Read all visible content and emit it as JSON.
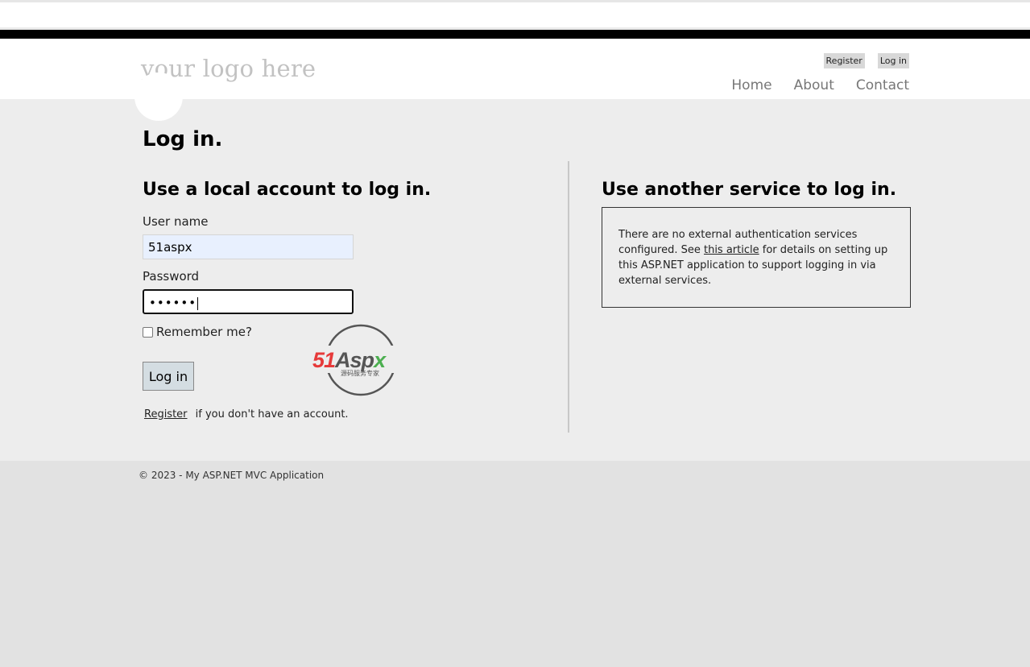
{
  "header": {
    "logo_text": "your logo here",
    "login_links": {
      "register": "Register",
      "login": "Log in"
    },
    "nav": {
      "home": "Home",
      "about": "About",
      "contact": "Contact"
    }
  },
  "main": {
    "title": "Log in.",
    "local": {
      "heading": "Use a local account to log in.",
      "username_label": "User name",
      "username_value": "51aspx",
      "password_label": "Password",
      "password_value": "••••••",
      "remember_label": "Remember me?",
      "remember_checked": false,
      "login_button": "Log in",
      "register_link": "Register",
      "register_suffix": "if you don't have an account."
    },
    "external": {
      "heading": "Use another service to log in.",
      "text_before": "There are no external authentication services configured. See",
      "link_text": "this article",
      "text_after": "for details on setting up this ASP.NET application to support logging in via external services."
    },
    "badge": {
      "brand": "51Aspx",
      "subtitle": "源码服务专家"
    }
  },
  "footer": {
    "copyright": "© 2023 - My ASP.NET MVC Application"
  }
}
